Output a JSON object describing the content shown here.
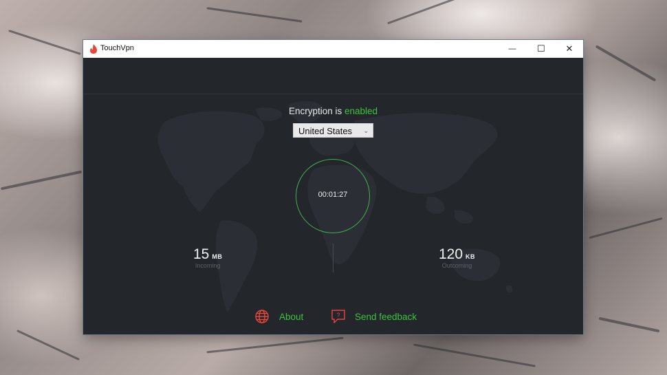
{
  "window": {
    "title": "TouchVpn"
  },
  "window_controls": {
    "minimize_symbol": "—",
    "maximize_symbol": "☐",
    "close_symbol": "✕"
  },
  "encryption": {
    "prefix": "Encryption is",
    "status": "enabled",
    "status_color": "#3ec33e"
  },
  "location": {
    "selected": "United States"
  },
  "connection": {
    "timer": "00:01:27",
    "ring_color": "#3fb34f"
  },
  "stats": {
    "incoming": {
      "value": "15",
      "unit": "MB",
      "label": "Incoming"
    },
    "outgoing": {
      "value": "120",
      "unit": "KB",
      "label": "Outcoming"
    }
  },
  "footer": {
    "about_label": "About",
    "feedback_label": "Send feedback",
    "accent_icon_color": "#e8473c",
    "link_color": "#3ec33e"
  },
  "icons": {
    "app": "flame-hand-icon",
    "about": "globe-icon",
    "feedback": "speech-bubble-question-icon"
  }
}
